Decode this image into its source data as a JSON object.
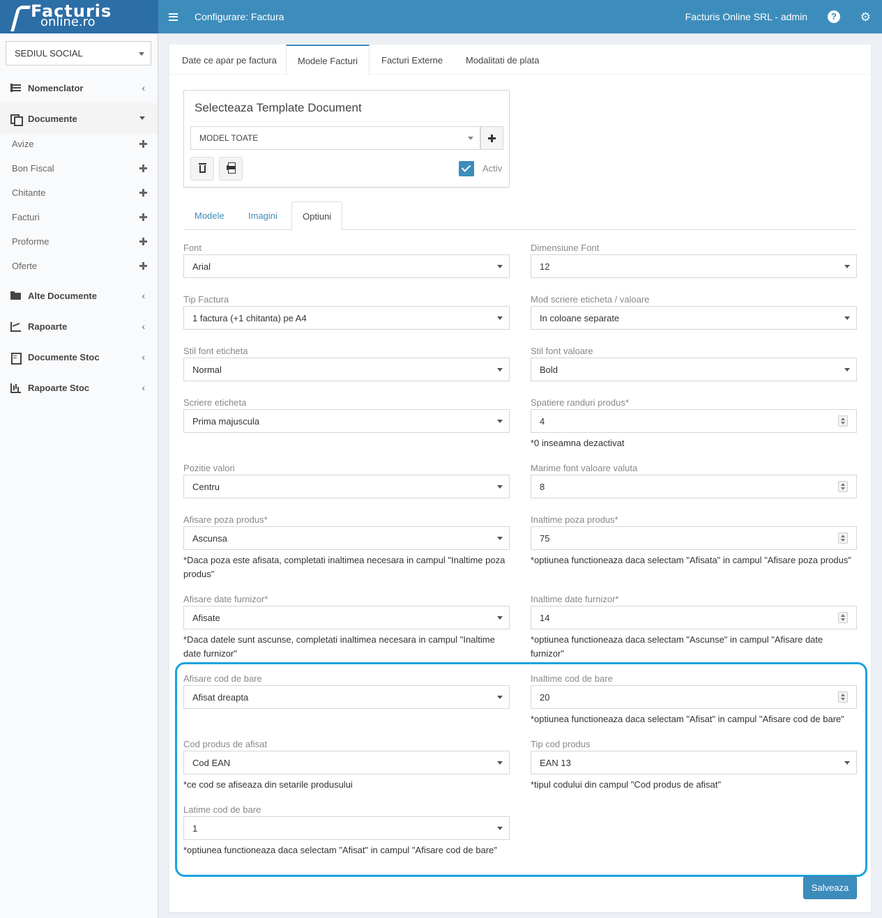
{
  "brand": {
    "line1": "Facturis",
    "line2": "online.ro"
  },
  "header": {
    "title": "Configurare: Factura",
    "user": "Facturis Online SRL - admin",
    "help_icon": "question-circle-icon",
    "settings_icon": "gears-icon"
  },
  "sidebar": {
    "location": "SEDIUL SOCIAL",
    "nav": [
      {
        "label": "Nomenclator",
        "icon": "list-icon"
      },
      {
        "label": "Documente",
        "icon": "copy-icon"
      },
      {
        "label": "Alte Documente",
        "icon": "folder-open-icon"
      },
      {
        "label": "Rapoarte",
        "icon": "line-chart-icon"
      },
      {
        "label": "Documente Stoc",
        "icon": "file-text-icon"
      },
      {
        "label": "Rapoarte Stoc",
        "icon": "bar-chart-icon"
      }
    ],
    "sub": [
      "Avize",
      "Bon Fiscal",
      "Chitante",
      "Facturi",
      "Proforme",
      "Oferte"
    ]
  },
  "tabs": [
    "Date ce apar pe factura",
    "Modele Facturi",
    "Facturi Externe",
    "Modalitati de plata"
  ],
  "template": {
    "title": "Selecteaza Template Document",
    "selected": "MODEL TOATE",
    "active_label": "Activ",
    "active_checked": true
  },
  "inner_tabs": [
    "Modele",
    "Imagini",
    "Optiuni"
  ],
  "form": {
    "font": {
      "label": "Font",
      "value": "Arial"
    },
    "font_size": {
      "label": "Dimensiune Font",
      "value": "12"
    },
    "tip_factura": {
      "label": "Tip Factura",
      "value": "1 factura (+1 chitanta) pe A4"
    },
    "mod_scriere": {
      "label": "Mod scriere eticheta / valoare",
      "value": "In coloane separate"
    },
    "stil_eticheta": {
      "label": "Stil font eticheta",
      "value": "Normal"
    },
    "stil_valoare": {
      "label": "Stil font valoare",
      "value": "Bold"
    },
    "scriere_eticheta": {
      "label": "Scriere eticheta",
      "value": "Prima majuscula"
    },
    "spatiere": {
      "label": "Spatiere randuri produs*",
      "value": "4",
      "help": "*0 inseamna dezactivat"
    },
    "pozitie": {
      "label": "Pozitie valori",
      "value": "Centru"
    },
    "marime_valuta": {
      "label": "Marime font valoare valuta",
      "value": "8"
    },
    "afisare_poza": {
      "label": "Afisare poza produs*",
      "value": "Ascunsa",
      "help": "*Daca poza este afisata, completati inaltimea necesara in campul \"Inaltime poza produs\""
    },
    "inaltime_poza": {
      "label": "Inaltime poza produs*",
      "value": "75",
      "help": "*optiunea functioneaza daca selectam \"Afisata\" in campul \"Afisare poza produs\""
    },
    "afisare_furnizor": {
      "label": "Afisare date furnizor*",
      "value": "Afisate",
      "help": "*Daca datele sunt ascunse, completati inaltimea necesara in campul \"Inaltime date furnizor\""
    },
    "inaltime_furnizor": {
      "label": "Inaltime date furnizor*",
      "value": "14",
      "help": "*optiunea functioneaza daca selectam \"Ascunse\" in campul \"Afisare date furnizor\""
    },
    "afisare_cod": {
      "label": "Afisare cod de bare",
      "value": "Afisat dreapta"
    },
    "inaltime_cod": {
      "label": "Inaltime cod de bare",
      "value": "20",
      "help": "*optiunea functioneaza daca selectam \"Afisat\" in campul \"Afisare cod de bare\""
    },
    "cod_produs": {
      "label": "Cod produs de afisat",
      "value": "Cod EAN",
      "help": "*ce cod se afiseaza din setarile produsului"
    },
    "tip_cod": {
      "label": "Tip cod produs",
      "value": "EAN 13",
      "help": "*tipul codului din campul \"Cod produs de afisat\""
    },
    "latime_cod": {
      "label": "Latime cod de bare",
      "value": "1",
      "help": "*optiunea functioneaza daca selectam \"Afisat\" in campul \"Afisare cod de bare\""
    }
  },
  "save_label": "Salveaza",
  "colors": {
    "header": "#3c8dbc",
    "logo_bg": "#2c6ea6",
    "highlight": "#1aa3dd"
  }
}
